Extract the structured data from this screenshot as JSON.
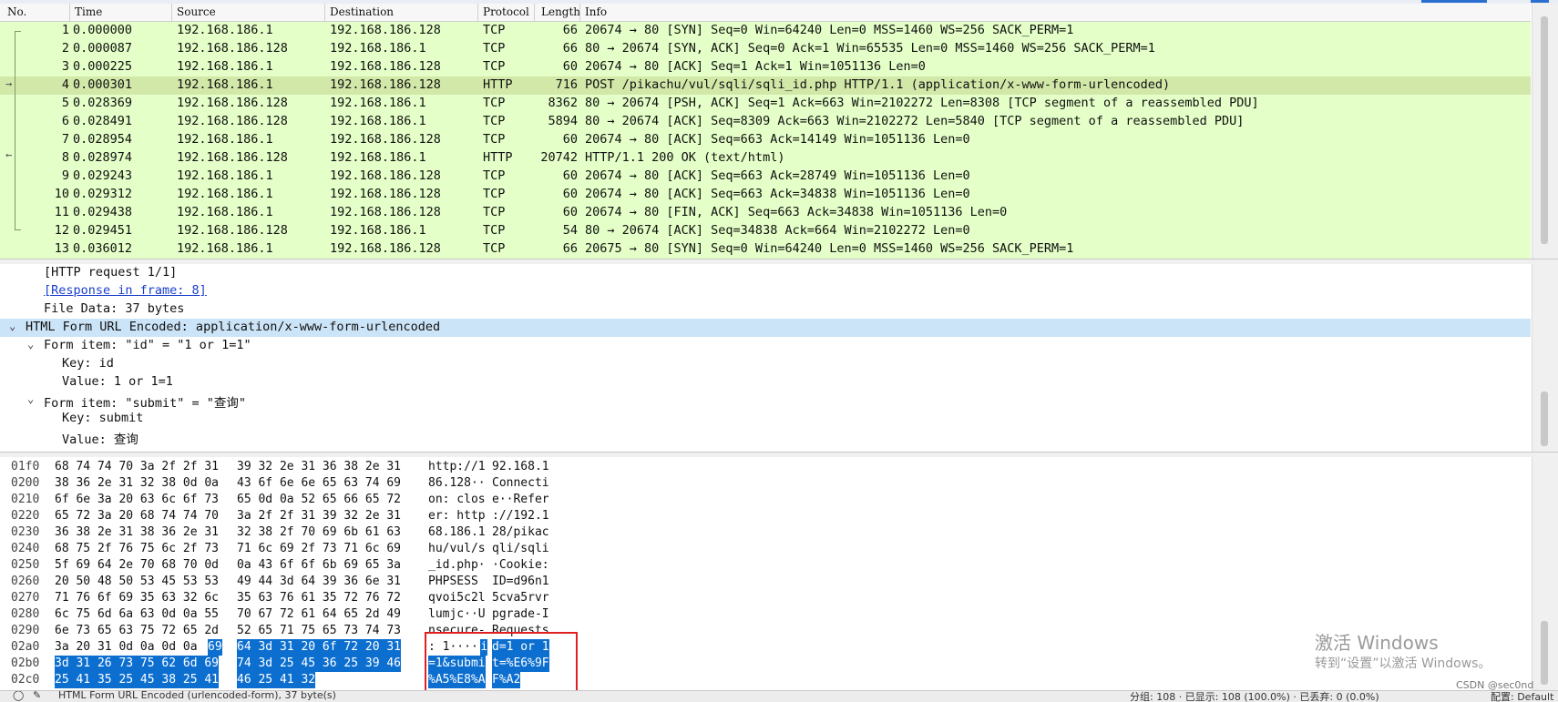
{
  "columns": [
    "No.",
    "Time",
    "Source",
    "Destination",
    "Protocol",
    "Length",
    "Info"
  ],
  "packets": [
    {
      "no": "1",
      "time": "0.000000",
      "src": "192.168.186.1",
      "dst": "192.168.186.128",
      "proto": "TCP",
      "len": "66",
      "info": "20674 → 80 [SYN] Seq=0 Win=64240 Len=0 MSS=1460 WS=256 SACK_PERM=1"
    },
    {
      "no": "2",
      "time": "0.000087",
      "src": "192.168.186.128",
      "dst": "192.168.186.1",
      "proto": "TCP",
      "len": "66",
      "info": "80 → 20674 [SYN, ACK] Seq=0 Ack=1 Win=65535 Len=0 MSS=1460 WS=256 SACK_PERM=1"
    },
    {
      "no": "3",
      "time": "0.000225",
      "src": "192.168.186.1",
      "dst": "192.168.186.128",
      "proto": "TCP",
      "len": "60",
      "info": "20674 → 80 [ACK] Seq=1 Ack=1 Win=1051136 Len=0"
    },
    {
      "no": "4",
      "time": "0.000301",
      "src": "192.168.186.1",
      "dst": "192.168.186.128",
      "proto": "HTTP",
      "len": "716",
      "info": "POST /pikachu/vul/sqli/sqli_id.php HTTP/1.1  (application/x-www-form-urlencoded)"
    },
    {
      "no": "5",
      "time": "0.028369",
      "src": "192.168.186.128",
      "dst": "192.168.186.1",
      "proto": "TCP",
      "len": "8362",
      "info": "80 → 20674 [PSH, ACK] Seq=1 Ack=663 Win=2102272 Len=8308 [TCP segment of a reassembled PDU]"
    },
    {
      "no": "6",
      "time": "0.028491",
      "src": "192.168.186.128",
      "dst": "192.168.186.1",
      "proto": "TCP",
      "len": "5894",
      "info": "80 → 20674 [ACK] Seq=8309 Ack=663 Win=2102272 Len=5840 [TCP segment of a reassembled PDU]"
    },
    {
      "no": "7",
      "time": "0.028954",
      "src": "192.168.186.1",
      "dst": "192.168.186.128",
      "proto": "TCP",
      "len": "60",
      "info": "20674 → 80 [ACK] Seq=663 Ack=14149 Win=1051136 Len=0"
    },
    {
      "no": "8",
      "time": "0.028974",
      "src": "192.168.186.128",
      "dst": "192.168.186.1",
      "proto": "HTTP",
      "len": "20742",
      "info": "HTTP/1.1 200 OK  (text/html)"
    },
    {
      "no": "9",
      "time": "0.029243",
      "src": "192.168.186.1",
      "dst": "192.168.186.128",
      "proto": "TCP",
      "len": "60",
      "info": "20674 → 80 [ACK] Seq=663 Ack=28749 Win=1051136 Len=0"
    },
    {
      "no": "10",
      "time": "0.029312",
      "src": "192.168.186.1",
      "dst": "192.168.186.128",
      "proto": "TCP",
      "len": "60",
      "info": "20674 → 80 [ACK] Seq=663 Ack=34838 Win=1051136 Len=0"
    },
    {
      "no": "11",
      "time": "0.029438",
      "src": "192.168.186.1",
      "dst": "192.168.186.128",
      "proto": "TCP",
      "len": "60",
      "info": "20674 → 80 [FIN, ACK] Seq=663 Ack=34838 Win=1051136 Len=0"
    },
    {
      "no": "12",
      "time": "0.029451",
      "src": "192.168.186.128",
      "dst": "192.168.186.1",
      "proto": "TCP",
      "len": "54",
      "info": "80 → 20674 [ACK] Seq=34838 Ack=664 Win=2102272 Len=0"
    },
    {
      "no": "13",
      "time": "0.036012",
      "src": "192.168.186.1",
      "dst": "192.168.186.128",
      "proto": "TCP",
      "len": "66",
      "info": "20675 → 80 [SYN] Seq=0 Win=64240 Len=0 MSS=1460 WS=256 SACK_PERM=1"
    }
  ],
  "selected_packet": "4",
  "details": {
    "http_request": "[HTTP request 1/1]",
    "response_link": "[Response in frame: 8]",
    "file_data": "File Data: 37 bytes",
    "form_header": "HTML Form URL Encoded: application/x-www-form-urlencoded",
    "item1": "Form item: \"id\" = \"1 or 1=1\"",
    "item1_key": "Key: id",
    "item1_value": "Value: 1 or 1=1",
    "item2": "Form item: \"submit\" = \"查询\"",
    "item2_key": "Key: submit",
    "item2_value": "Value: 查询"
  },
  "bytes": [
    {
      "off": "01f0",
      "hex_a": "68 74 74 70 3a 2f 2f 31",
      "hex_b": "39 32 2e 31 36 38 2e 31",
      "asc_a": "http://1",
      "asc_b": "92.168.1"
    },
    {
      "off": "0200",
      "hex_a": "38 36 2e 31 32 38 0d 0a",
      "hex_b": "43 6f 6e 6e 65 63 74 69",
      "asc_a": "86.128··",
      "asc_b": "Connecti"
    },
    {
      "off": "0210",
      "hex_a": "6f 6e 3a 20 63 6c 6f 73",
      "hex_b": "65 0d 0a 52 65 66 65 72",
      "asc_a": "on: clos",
      "asc_b": "e··Refer"
    },
    {
      "off": "0220",
      "hex_a": "65 72 3a 20 68 74 74 70",
      "hex_b": "3a 2f 2f 31 39 32 2e 31",
      "asc_a": "er: http",
      "asc_b": "://192.1"
    },
    {
      "off": "0230",
      "hex_a": "36 38 2e 31 38 36 2e 31",
      "hex_b": "32 38 2f 70 69 6b 61 63",
      "asc_a": "68.186.1",
      "asc_b": "28/pikac"
    },
    {
      "off": "0240",
      "hex_a": "68 75 2f 76 75 6c 2f 73",
      "hex_b": "71 6c 69 2f 73 71 6c 69",
      "asc_a": "hu/vul/s",
      "asc_b": "qli/sqli"
    },
    {
      "off": "0250",
      "hex_a": "5f 69 64 2e 70 68 70 0d",
      "hex_b": "0a 43 6f 6f 6b 69 65 3a",
      "asc_a": "_id.php·",
      "asc_b": "·Cookie:"
    },
    {
      "off": "0260",
      "hex_a": "20 50 48 50 53 45 53 53",
      "hex_b": "49 44 3d 64 39 36 6e 31",
      "asc_a": " PHPSESS",
      "asc_b": "ID=d96n1"
    },
    {
      "off": "0270",
      "hex_a": "71 76 6f 69 35 63 32 6c",
      "hex_b": "35 63 76 61 35 72 76 72",
      "asc_a": "qvoi5c2l",
      "asc_b": "5cva5rvr"
    },
    {
      "off": "0280",
      "hex_a": "6c 75 6d 6a 63 0d 0a 55",
      "hex_b": "70 67 72 61 64 65 2d 49",
      "asc_a": "lumjc··U",
      "asc_b": "pgrade-I"
    },
    {
      "off": "0290",
      "hex_a": "6e 73 65 63 75 72 65 2d",
      "hex_b": "52 65 71 75 65 73 74 73",
      "asc_a": "nsecure-",
      "asc_b": "Requests"
    },
    {
      "off": "02a0",
      "hex_a": "3a 20 31 0d 0a 0d 0a",
      "hex_a_sel": "69",
      "hex_b": "64 3d 31 20 6f 72 20 31",
      "asc_a": ": 1····",
      "asc_a_sel": "i",
      "asc_b": "d=1 or 1"
    },
    {
      "off": "02b0",
      "hex_a": "3d 31 26 73 75 62 6d 69",
      "hex_b": "74 3d 25 45 36 25 39 46",
      "asc_a": "=1&submi",
      "asc_b": "t=%E6%9F"
    },
    {
      "off": "02c0",
      "hex_a": "25 41 35 25 45 38 25 41",
      "hex_b": "46 25 41 32",
      "asc_a": "%A5%E8%A",
      "asc_b": "F%A2"
    }
  ],
  "watermark": {
    "line1": "激活 Windows",
    "line2": "转到“设置”以激活 Windows。"
  },
  "credit": "CSDN @sec0nd_",
  "status": {
    "left": "HTML Form URL Encoded (urlencoded-form), 37 byte(s)",
    "packets": "分组: 108 · 已显示: 108 (100.0%) · 已丢弃: 0 (0.0%)",
    "profile": "配置: Default"
  },
  "colors": {
    "tcp_row": "#e4ffc7",
    "selected_row": "#d2e8a8",
    "highlight_tree": "#cce4f7",
    "byte_selection": "#0c6fd0",
    "annotation_box": "#e02020",
    "link": "#1a3ecc"
  }
}
